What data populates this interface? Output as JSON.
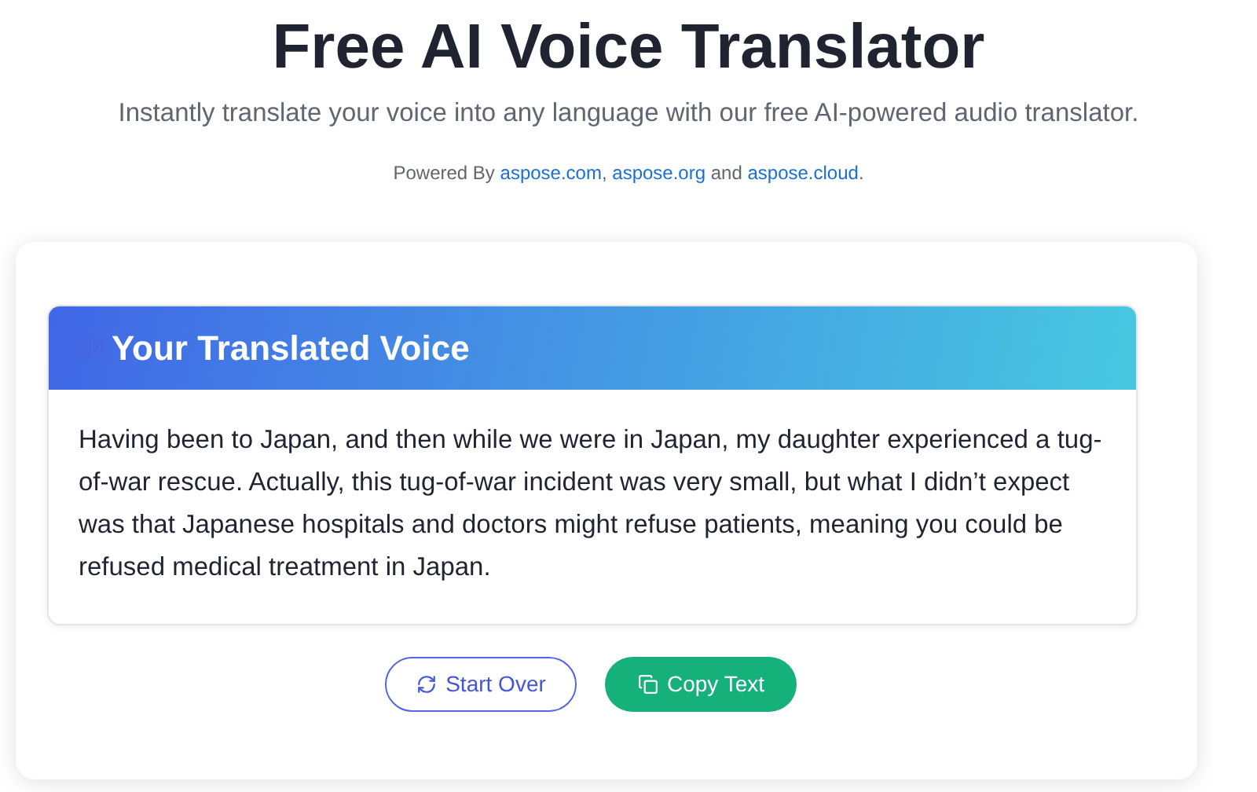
{
  "title": "Free AI Voice Translator",
  "subtitle": "Instantly translate your voice into any language with our free AI-powered audio translator.",
  "powered": {
    "prefix": "Powered By",
    "links": [
      "aspose.com",
      "aspose.org",
      "aspose.cloud"
    ],
    "separator": ",",
    "conjunction": "and",
    "suffix": "."
  },
  "result": {
    "heading": "Your Translated Voice",
    "text": "Having been to Japan, and then while we were in Japan, my daughter experienced a tug-of-war rescue. Actually, this tug-of-war incident was very small, but what I didn’t expect was that Japanese hospitals and doctors might refuse patients, meaning you could be refused medical treatment in Japan."
  },
  "buttons": [
    {
      "label": "Start Over",
      "kind": "outline"
    },
    {
      "label": "Copy Text",
      "kind": "filled"
    }
  ]
}
